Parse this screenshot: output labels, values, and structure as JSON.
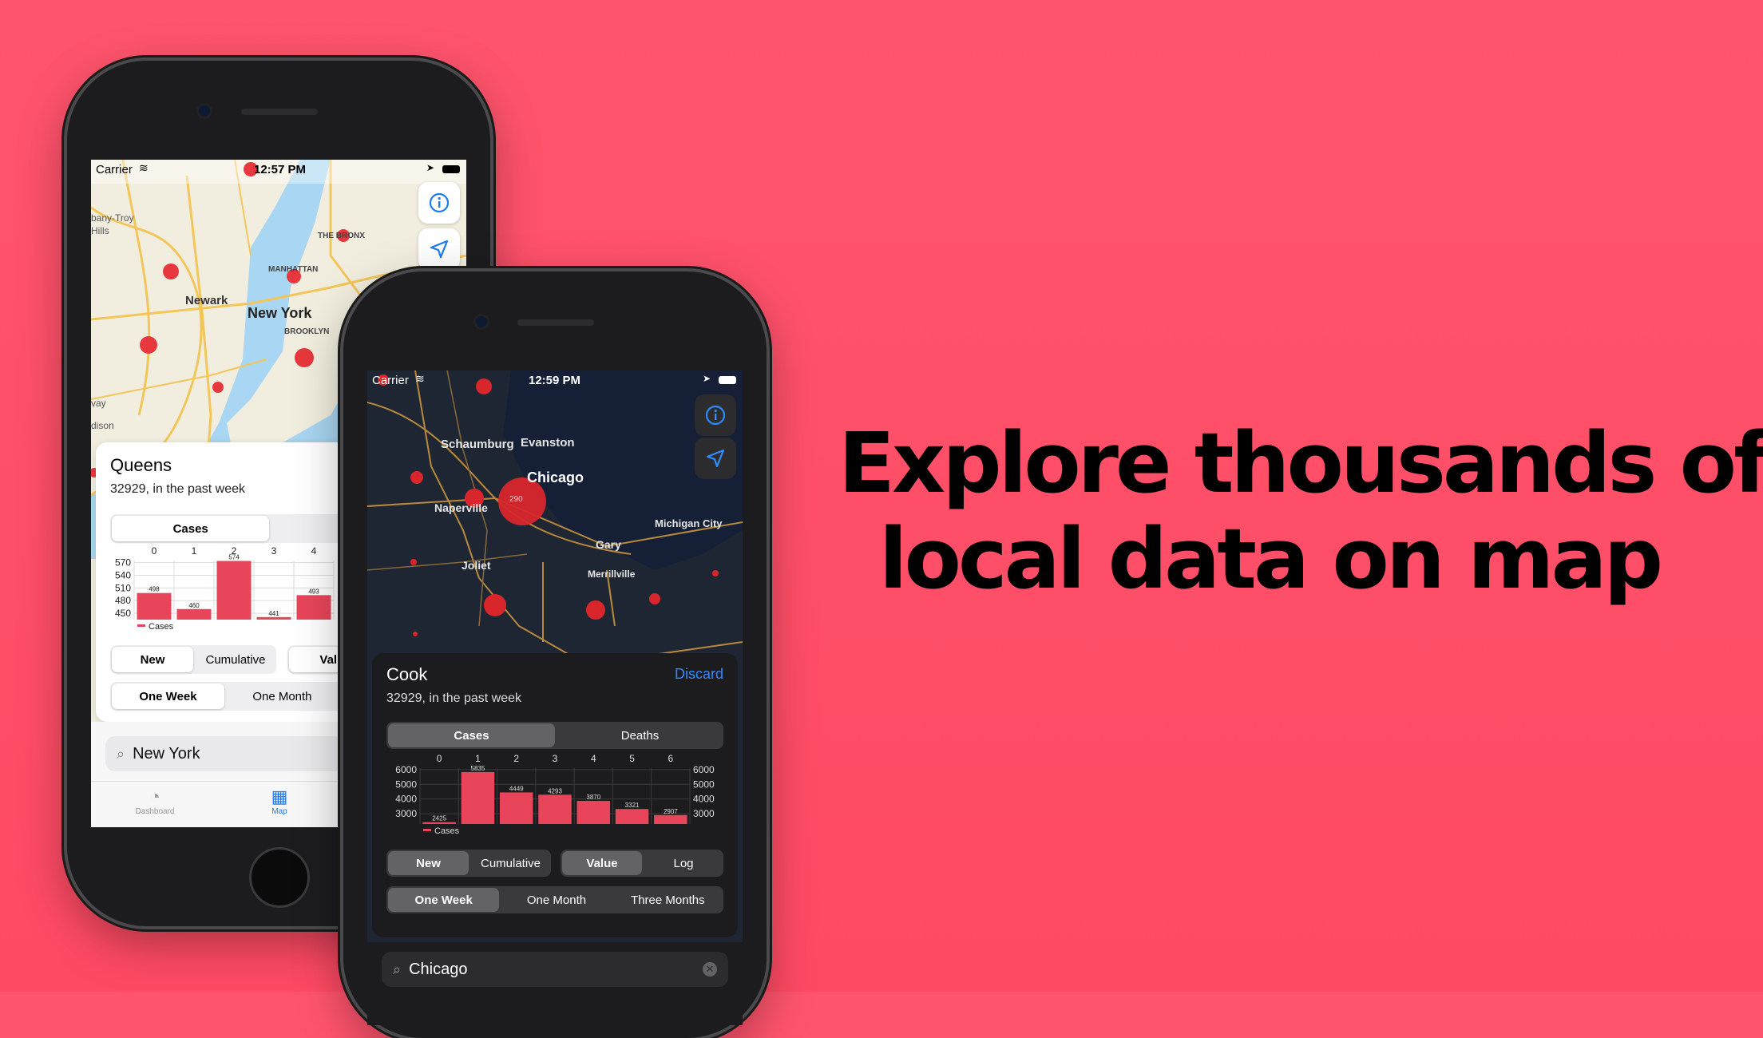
{
  "headline": {
    "line1": "Explore thousands of",
    "line2": "local data on map"
  },
  "phone_light": {
    "status": {
      "carrier": "Carrier",
      "time": "12:57 PM"
    },
    "map_labels": {
      "city_main": "New York",
      "city_newark": "Newark",
      "manhattan": "MANHATTAN",
      "bronx": "THE BRONX",
      "brooklyn": "BROOKLYN",
      "albany": "bany-Troy",
      "hills": "Hills",
      "way": "vay",
      "edison": "dison"
    },
    "card": {
      "title": "Queens",
      "subtitle": "32929, in the past week",
      "metric_tabs": [
        "Cases",
        ""
      ],
      "mode_seg": [
        "New",
        "Cumulative"
      ],
      "scale_seg": [
        "Value"
      ],
      "range_seg": [
        "One Week",
        "One Month",
        ""
      ]
    },
    "chart_data": {
      "type": "bar",
      "categories": [
        "0",
        "1",
        "2",
        "3",
        "4"
      ],
      "values": [
        498,
        460,
        574,
        441,
        493
      ],
      "yticks": [
        "570",
        "540",
        "510",
        "480",
        "450"
      ],
      "legend": "Cases",
      "color": "#e8455a"
    },
    "search": {
      "value": "New York"
    },
    "tabbar": {
      "items": [
        "Dashboard",
        "Map"
      ],
      "active": "Map"
    },
    "colors": {
      "accent": "#1a7cf5",
      "marker": "#e8383d"
    }
  },
  "phone_dark": {
    "status": {
      "carrier": "Carrier",
      "time": "12:59 PM"
    },
    "map_labels": {
      "city_main": "Chicago",
      "schaumburg": "Schaumburg",
      "evanston": "Evanston",
      "naperville": "Naperville",
      "joliet": "Joliet",
      "gary": "Gary",
      "merrillville": "Merrillville",
      "michigan_city": "Michigan City",
      "bubble": "290"
    },
    "card": {
      "title": "Cook",
      "subtitle": "32929, in the past week",
      "discard": "Discard",
      "metric_tabs": [
        "Cases",
        "Deaths"
      ],
      "mode_seg": [
        "New",
        "Cumulative"
      ],
      "scale_seg": [
        "Value",
        "Log"
      ],
      "range_seg": [
        "One Week",
        "One Month",
        "Three Months"
      ]
    },
    "chart_data": {
      "type": "bar",
      "categories": [
        "0",
        "1",
        "2",
        "3",
        "4",
        "5",
        "6"
      ],
      "values": [
        2425,
        5835,
        4449,
        4293,
        3870,
        3321,
        2907
      ],
      "yticks": [
        "6000",
        "5000",
        "4000",
        "3000"
      ],
      "legend": "Cases",
      "color": "#e8455a"
    },
    "search": {
      "value": "Chicago"
    }
  }
}
